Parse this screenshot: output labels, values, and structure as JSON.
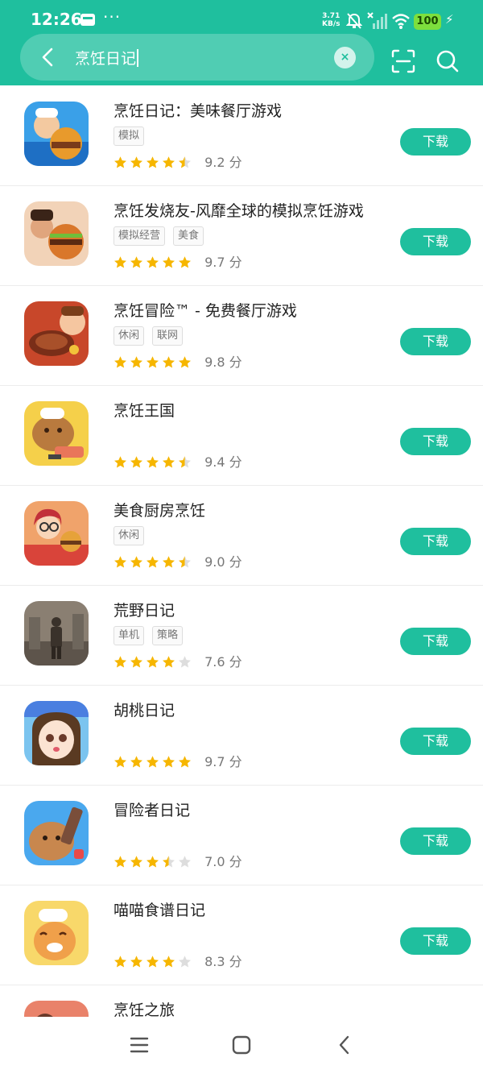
{
  "status_bar": {
    "time": "12:26",
    "dots": "···",
    "net_speed_value": "3.71",
    "net_speed_unit": "KB/s",
    "battery": "100",
    "icons": [
      "notification-icon",
      "mute-icon",
      "signal-icon",
      "wifi-icon",
      "charging-icon"
    ]
  },
  "search": {
    "query": "烹饪日记",
    "clear_glyph": "×"
  },
  "apps": [
    {
      "name": "烹饪日记：美味餐厅游戏",
      "tags": [
        "模拟"
      ],
      "rating": 4.5,
      "score": "9.2 分",
      "download": "下载"
    },
    {
      "name": "烹饪发烧友-风靡全球的模拟烹饪游戏",
      "tags": [
        "模拟经营",
        "美食"
      ],
      "rating": 5,
      "score": "9.7 分",
      "download": "下载"
    },
    {
      "name": "烹饪冒险™ - 免费餐厅游戏",
      "tags": [
        "休闲",
        "联网"
      ],
      "rating": 5,
      "score": "9.8 分",
      "download": "下载"
    },
    {
      "name": "烹饪王国",
      "tags": [],
      "rating": 4.5,
      "score": "9.4 分",
      "download": "下载"
    },
    {
      "name": "美食厨房烹饪",
      "tags": [
        "休闲"
      ],
      "rating": 4.5,
      "score": "9.0 分",
      "download": "下载"
    },
    {
      "name": "荒野日记",
      "tags": [
        "单机",
        "策略"
      ],
      "rating": 4,
      "score": "7.6 分",
      "download": "下载"
    },
    {
      "name": "胡桃日记",
      "tags": [],
      "rating": 5,
      "score": "9.7 分",
      "download": "下载"
    },
    {
      "name": "冒险者日记",
      "tags": [],
      "rating": 3.5,
      "score": "7.0 分",
      "download": "下载"
    },
    {
      "name": "喵喵食谱日记",
      "tags": [],
      "rating": 4,
      "score": "8.3 分",
      "download": "下载"
    },
    {
      "name": "烹饪之旅",
      "tags": [],
      "rating": null,
      "score": "",
      "download": ""
    }
  ],
  "colors": {
    "accent": "#1fbf9e",
    "star": "#f6b600",
    "star_empty": "#dddddd"
  }
}
